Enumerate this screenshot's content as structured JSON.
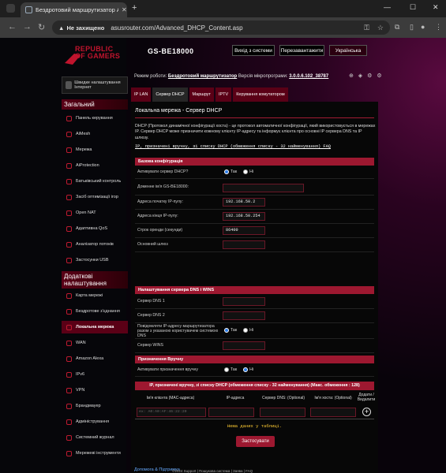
{
  "browser": {
    "tab_title": "Бездротовий маршрутизатор A",
    "address_warning": "Не захищено",
    "url": "asusrouter.com/Advanced_DHCP_Content.asp"
  },
  "header": {
    "logo_text": "REPUBLIC OF GAMERS",
    "model": "GS-BE18000",
    "logout": "Вихід з системи",
    "reboot": "Перезавантажити",
    "language": "Українська",
    "mode_label": "Режим роботи:",
    "mode_value": "Бездротовий маршрутизатор",
    "firmware_label": "Версія мікропрограми:",
    "firmware_value": "3.0.0.6.102_38787"
  },
  "sidebar": {
    "quick_setup": "Швидке налаштування Інтернет",
    "general_title": "Загальний",
    "general": [
      "Панель керування",
      "AiMesh",
      "Мережа",
      "AiProtection",
      "Батьківський контроль",
      "Засіб оптимізації ігор",
      "Open NAT",
      "Адаптивна QoS",
      "Аналізатор потоків",
      "Застосунки USB"
    ],
    "advanced_title": "Додаткові налаштування",
    "advanced": [
      "Карта мережі",
      "Бездротове з'єднання",
      "Локальна мережа",
      "WAN",
      "Amazon Alexa",
      "IPv6",
      "VPN",
      "Брандмауер",
      "Адміністрування",
      "Системний журнал",
      "Мережеві інструменти"
    ]
  },
  "tabs": [
    "IP LAN",
    "Сервер DHCP",
    "Маршрут",
    "IPTV",
    "Керування комутатором"
  ],
  "content": {
    "title": "Локальна мережа - Сервер DHCP",
    "description": "DHCP (Протокол динамічної конфігурації хоста) - це протокол автоматичної конфігурації, який використовується в мережах IP. Сервер DHCP може призначити кожному клієнту IP-адресу та інформує клієнта про основні IP сервера DNS та IP шлюзу.",
    "faq": "IP, призначені вручну, зі списку DHCP (обмеження списку - 32 найменування) FAQ",
    "basic_title": "Базова конфігурація",
    "enable_dhcp": "Активувати сервер DHCP?",
    "domain": "Доменне ім'я GS-BE18000:",
    "pool_start": "Адреса початку IP-пулу:",
    "pool_start_val": "192.168.50.2",
    "pool_end": "Адреса кінця IP-пулу:",
    "pool_end_val": "192.168.50.254",
    "lease": "Строк оренди (секунди)",
    "lease_val": "86400",
    "gateway": "Основний шлюз",
    "dns_title": "Налаштування сервера DNS і WINS",
    "dns1": "Сервер DNS 1",
    "dns2": "Сервер DNS 2",
    "advertise": "Повідомляти IP-адресу маршрутизатора разом з указаною користувачем системою DNS",
    "wins": "Сервер WINS",
    "manual_title": "Призначення Вручну",
    "enable_manual": "Активувати призначення вручну",
    "yes": "Так",
    "no": "Ні",
    "table_title": "IP, призначені вручну, зі списку DHCP (обмеження списку - 32 найменування) (Макс. обмеження : 128)",
    "col_name": "Ім'я клієнта (MAC-адреса)",
    "col_ip": "IP-адреса",
    "col_dns": "Сервер DNS: (Optional)",
    "col_host": "Ім'я хоста: (Optional)",
    "col_add": "Додати / Видалити",
    "mac_placeholder": "ex: A0:A0:AF:46:22:20",
    "no_data": "Нема даних у таблиці.",
    "apply": "Застосувати"
  },
  "footer": {
    "help": "Допомога & Підтримка",
    "links": "©2024 Support | Пошукова система | Заява | FAQ"
  }
}
